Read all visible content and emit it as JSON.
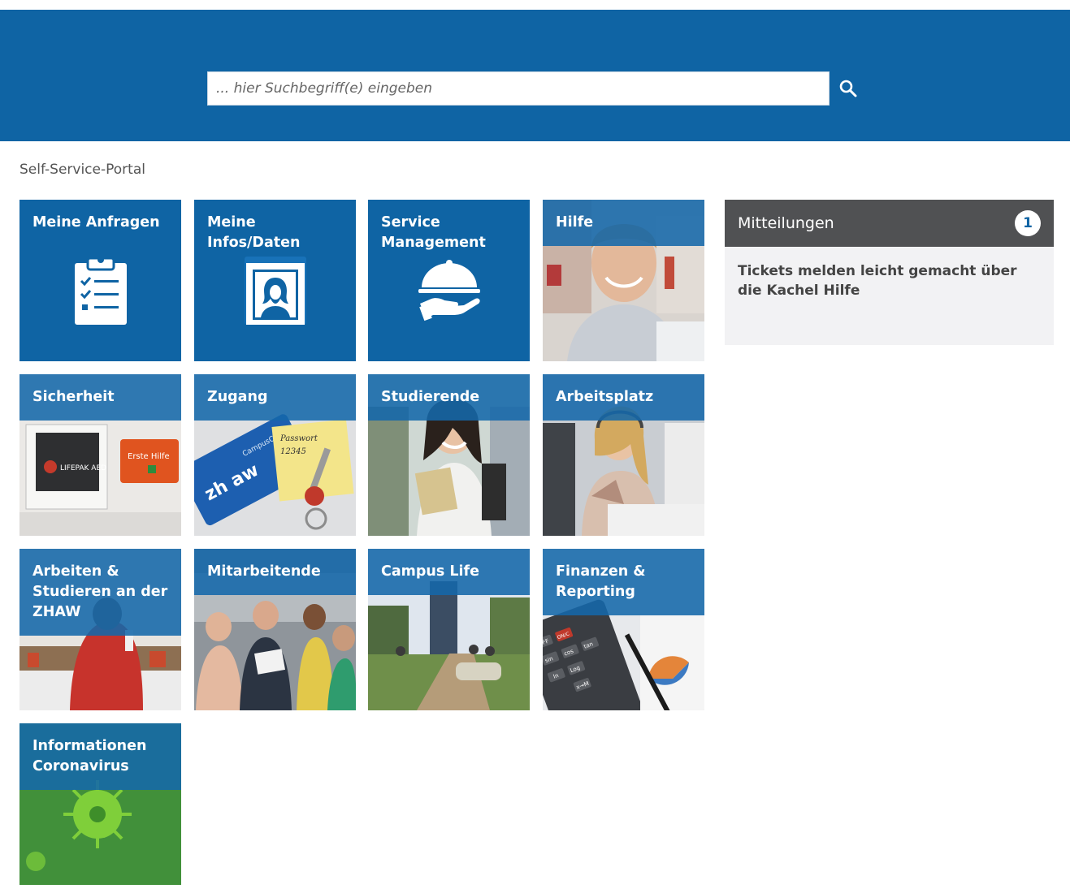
{
  "search": {
    "placeholder": "... hier Suchbegriff(e) eingeben"
  },
  "breadcrumb": "Self-Service-Portal",
  "tiles": [
    {
      "title": "Meine Anfragen"
    },
    {
      "title": "Meine Infos/Daten"
    },
    {
      "title": "Service Management"
    },
    {
      "title": "Hilfe"
    },
    {
      "title": "Sicherheit"
    },
    {
      "title": "Zugang"
    },
    {
      "title": "Studierende"
    },
    {
      "title": "Arbeitsplatz"
    },
    {
      "title": "Arbeiten & Studieren an der ZHAW"
    },
    {
      "title": "Mitarbeitende"
    },
    {
      "title": "Campus Life"
    },
    {
      "title": "Finanzen & Reporting"
    },
    {
      "title": "Informationen Coronavirus"
    }
  ],
  "photo_text": {
    "aed_label": "LIFEPAK AED",
    "first_aid": "Erste Hilfe",
    "card_brand": "zh aw",
    "card_name": "CampusCard",
    "password_label": "Passwort",
    "password_value": "12345",
    "calc_keys": [
      "OFF",
      "ON/C",
      "sin",
      "cos",
      "tan",
      "ln",
      "Log",
      "x→M"
    ]
  },
  "notifications": {
    "title": "Mitteilungen",
    "count": "1",
    "message": "Tickets melden leicht gemacht über die Kachel Hilfe"
  },
  "colors": {
    "header_blue": "#0f64a4",
    "tile_blue": "#0f64a4",
    "notice_head": "#505153",
    "notice_body": "#f2f2f4"
  }
}
